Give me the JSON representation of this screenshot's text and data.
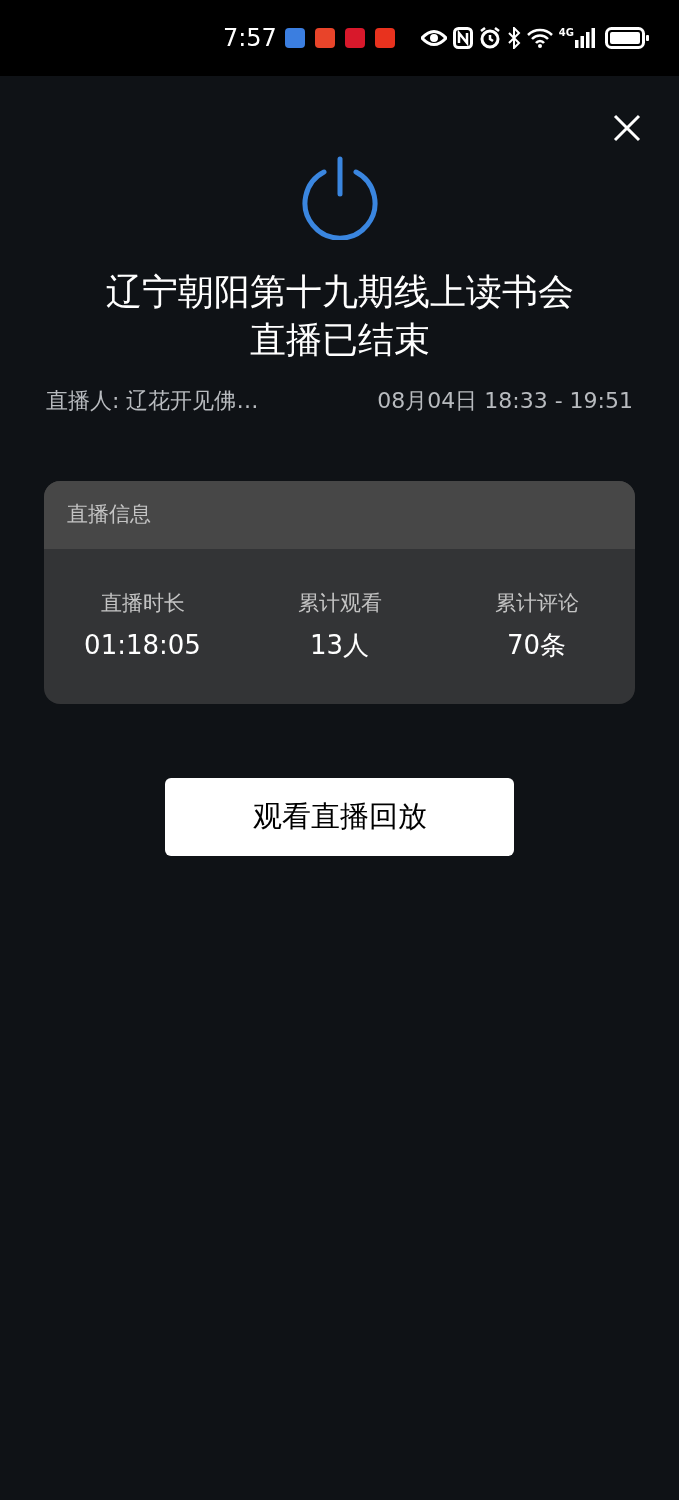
{
  "status_bar": {
    "time": "7:57",
    "network": "4G",
    "notification_apps": [
      {
        "color": "#3b7ee0"
      },
      {
        "color": "#e8442a"
      },
      {
        "color": "#d8182b"
      },
      {
        "color": "#e8321e"
      }
    ]
  },
  "title_lines": [
    "辽宁朝阳第十九期线上读书会",
    "直播已结束"
  ],
  "host": "直播人: 辽花开见佛…",
  "time_range": "08月04日 18:33 - 19:51",
  "info_card": {
    "title": "直播信息",
    "stats": [
      {
        "label": "直播时长",
        "value": "01:18:05"
      },
      {
        "label": "累计观看",
        "value": "13人"
      },
      {
        "label": "累计评论",
        "value": "70条"
      }
    ]
  },
  "replay_button": "观看直播回放"
}
